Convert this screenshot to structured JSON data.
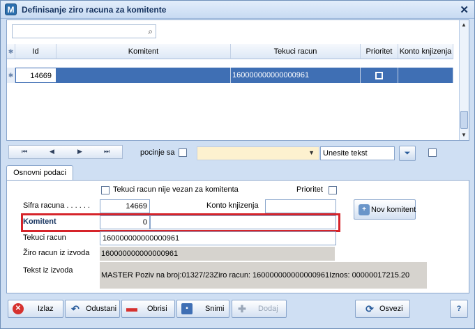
{
  "window": {
    "title": "Definisanje ziro racuna za komitente",
    "icon_letter": "M"
  },
  "search": {
    "placeholder": ""
  },
  "grid": {
    "columns": [
      "Id",
      "Komitent",
      "Tekuci racun",
      "Prioritet",
      "Konto knjizenja"
    ],
    "rows": [
      {
        "id": "14669",
        "komitent": "",
        "tekuci_racun": "160000000000000961",
        "prioritet": false,
        "konto": ""
      }
    ]
  },
  "navbar": {
    "pocinje_sa_label": "pocinje sa",
    "text_input_value": "Unesite tekst",
    "combo_value": ""
  },
  "tabs": [
    "Osnovni podaci"
  ],
  "form": {
    "tekuci_nije_vezan_label": "Tekuci racun nije vezan za komitenta",
    "prioritet_label": "Prioritet",
    "sifra_racuna_label": "Sifra racuna . . . . . .",
    "sifra_racuna_value": "14669",
    "konto_knjizenja_label": "Konto knjizenja",
    "konto_knjizenja_value": "",
    "komitent_label": "Komitent",
    "komitent_code": "0",
    "komitent_name": "",
    "tekuci_racun_label": "Tekuci racun",
    "tekuci_racun_value": "160000000000000961",
    "ziro_izvoda_label": "Žiro racun iz izvoda",
    "ziro_izvoda_value": "160000000000000961",
    "tekst_izvoda_label": "Tekst iz izvoda",
    "tekst_izvoda_value": "MASTER Poziv na broj:01327/23Ziro racun: 160000000000000961Iznos: 00000017215.20",
    "novi_komitent_label": "Nov komitent"
  },
  "buttons": {
    "izlaz": "Izlaz",
    "odustani": "Odustani",
    "obrisi": "Obrisi",
    "snimi": "Snimi",
    "dodaj": "Dodaj",
    "osvezi": "Osvezi",
    "help": "?"
  },
  "colors": {
    "accent": "#3f6fb4",
    "highlight": "#d6242a",
    "combo_bg": "#fdf1cf"
  }
}
